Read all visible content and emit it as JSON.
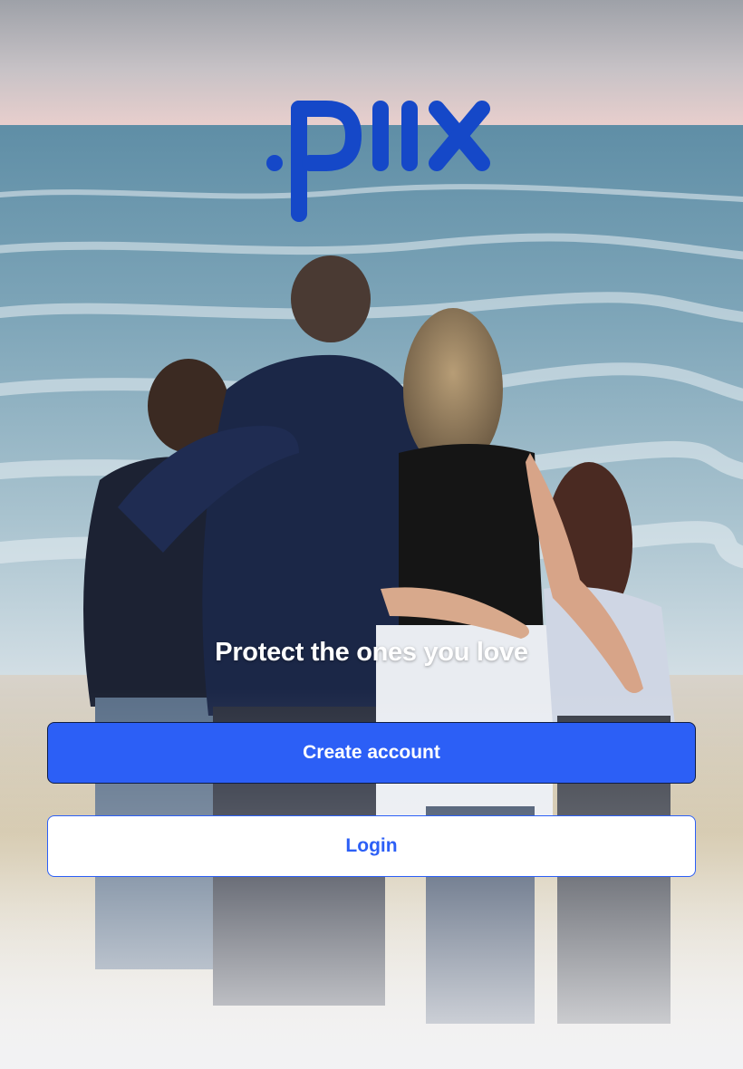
{
  "brand": {
    "logo_text": "piix",
    "logo_color": "#1548c8"
  },
  "welcome": {
    "tagline": "Protect the ones you love"
  },
  "actions": {
    "create_account_label": "Create account",
    "login_label": "Login"
  },
  "colors": {
    "primary": "#2c5ff6",
    "button_text_light": "#ffffff",
    "create_border": "#0e1c44"
  },
  "background": {
    "description_icon": "family-beach-photo"
  }
}
